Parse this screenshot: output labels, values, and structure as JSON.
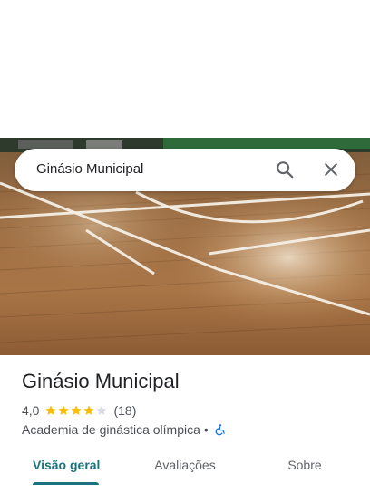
{
  "search": {
    "query": "Ginásio Municipal"
  },
  "place": {
    "name": "Ginásio Municipal",
    "rating": "4,0",
    "rating_value": 4.0,
    "rating_max": 5,
    "review_count": "(18)",
    "category": "Academia de ginástica olímpica",
    "separator": "•",
    "accessibility_icon": "wheelchair-accessible-icon"
  },
  "tabs": [
    {
      "label": "Visão geral",
      "active": true
    },
    {
      "label": "Avaliações",
      "active": false
    },
    {
      "label": "Sobre",
      "active": false
    }
  ],
  "colors": {
    "accent": "#1a737e",
    "star": "#fbbc04",
    "star_empty": "#dadce0",
    "accessibility": "#1a73e8"
  }
}
